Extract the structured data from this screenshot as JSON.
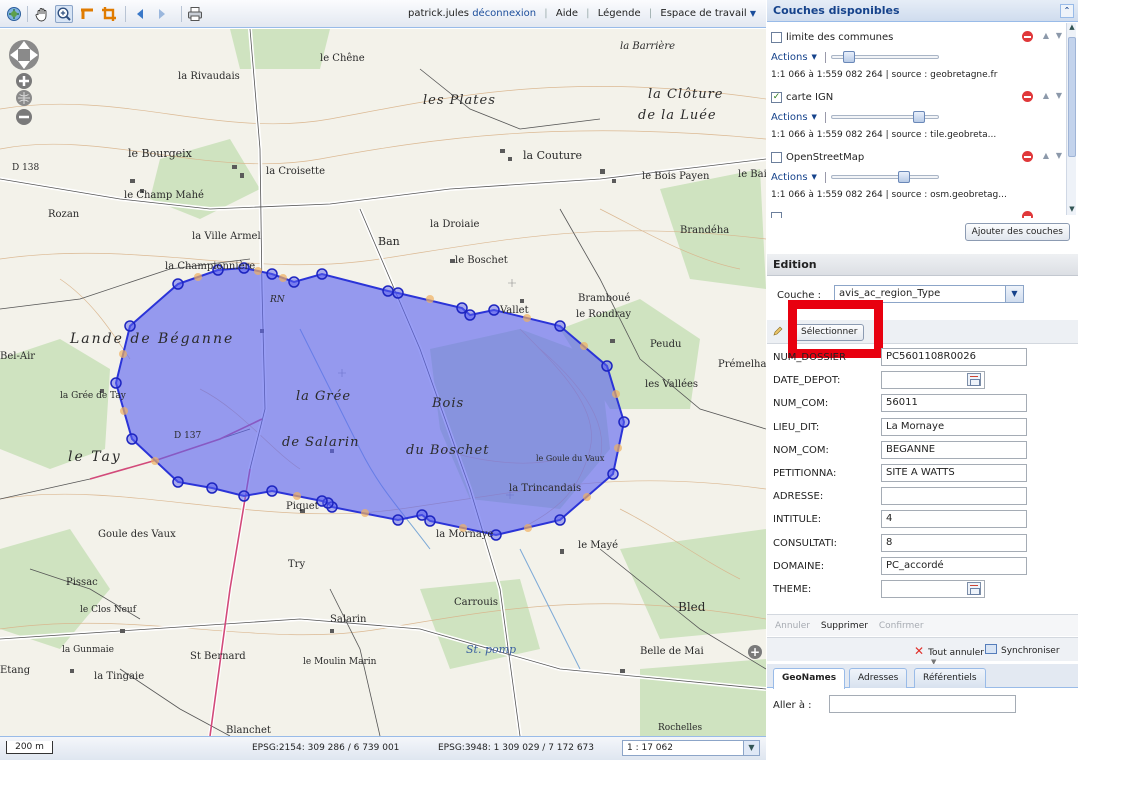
{
  "toolbar": {
    "user": "patrick.jules",
    "logout": "déconnexion",
    "help": "Aide",
    "legend": "Légende",
    "workspace": "Espace de travail"
  },
  "map": {
    "places": [
      "la Barrière",
      "le Chêne",
      "la Rivaudais",
      "les Plates",
      "la Clôture",
      "de la Luée",
      "le Bourgeix",
      "la Croisette",
      "la Couture",
      "le Bois Payen",
      "le Bail",
      "le Champ Mahé",
      "Rozan",
      "la Droiaie",
      "Ban",
      "la Ville Armel",
      "Brandéha",
      "le Boschet",
      "la Championnière",
      "Bramboué",
      "le Rondray",
      "Vallet",
      "Lande de Béganne",
      "Peudu",
      "Prémelhan",
      "Bel-Air",
      "les Vallées",
      "la Grée de Tay",
      "la Grée",
      "Bois",
      "de Salarin",
      "du Boschet",
      "le Tay",
      "D 137",
      "la Trincandais",
      "Piquet",
      "la Mornaye",
      "le Mayé",
      "Goule des Vaux",
      "Try",
      "Pissac",
      "le Clos Neuf",
      "Carrouis",
      "Salarin",
      "Bled",
      "St. pomp",
      "la Gunmaie",
      "St Bernard",
      "Etang",
      "la Tingaie",
      "le Moulin Marin",
      "Belle de Mai",
      "Blanchet",
      "Rochelles",
      "le Goule du Vaux",
      "D 138",
      "RN"
    ]
  },
  "statusbar": {
    "scale_label": "200 m",
    "coord_2154": "EPSG:2154: 309 286 / 6 739 001",
    "coord_3948": "EPSG:3948: 1 309 029 / 7 172 673",
    "scale_value": "1 : 17 062"
  },
  "layers_panel": {
    "title": "Couches disponibles",
    "actions_label": "Actions",
    "add_button": "Ajouter des couches",
    "layers": [
      {
        "name": "limite des communes",
        "checked": false,
        "info": "1:1 066 à 1:559 082 264 | source : geobretagne.fr",
        "opacity": 0.12
      },
      {
        "name": "carte IGN",
        "checked": true,
        "info": "1:1 066 à 1:559 082 264 | source : tile.geobreta...",
        "opacity": 0.85
      },
      {
        "name": "OpenStreetMap",
        "checked": false,
        "info": "1:1 066 à 1:559 082 264 | source : osm.geobretag...",
        "opacity": 0.7
      }
    ]
  },
  "edition": {
    "title": "Edition",
    "layer_label": "Couche :",
    "layer_value": "avis_ac_region_Type",
    "select_button": "Sélectionner",
    "fields": [
      {
        "label": "NUM_DOSSIER",
        "value": "PC5601108R0026",
        "date": false
      },
      {
        "label": "DATE_DEPOT:",
        "value": "",
        "date": true
      },
      {
        "label": "NUM_COM:",
        "value": "56011",
        "date": false
      },
      {
        "label": "LIEU_DIT:",
        "value": "La Mornaye",
        "date": false
      },
      {
        "label": "NOM_COM:",
        "value": "BEGANNE",
        "date": false
      },
      {
        "label": "PETITIONNA:",
        "value": "SITE A WATTS",
        "date": false
      },
      {
        "label": "ADRESSE:",
        "value": "",
        "date": false
      },
      {
        "label": "INTITULE:",
        "value": "4",
        "date": false
      },
      {
        "label": "CONSULTATI:",
        "value": "8",
        "date": false
      },
      {
        "label": "DOMAINE:",
        "value": "PC_accordé",
        "date": false
      },
      {
        "label": "THEME:",
        "value": "",
        "date": true
      }
    ],
    "cancel": "Annuler",
    "delete": "Supprimer",
    "confirm": "Confirmer",
    "cancel_all": "Tout annuler",
    "sync": "Synchroniser"
  },
  "search": {
    "tabs": [
      "GeoNames",
      "Adresses",
      "Référentiels"
    ],
    "goto_label": "Aller à :",
    "goto_value": ""
  },
  "colors": {
    "polygon_fill": "#5b62f0",
    "polygon_stroke": "#2b34d8",
    "highlight": "#e8000f",
    "header_text": "#15428b"
  }
}
